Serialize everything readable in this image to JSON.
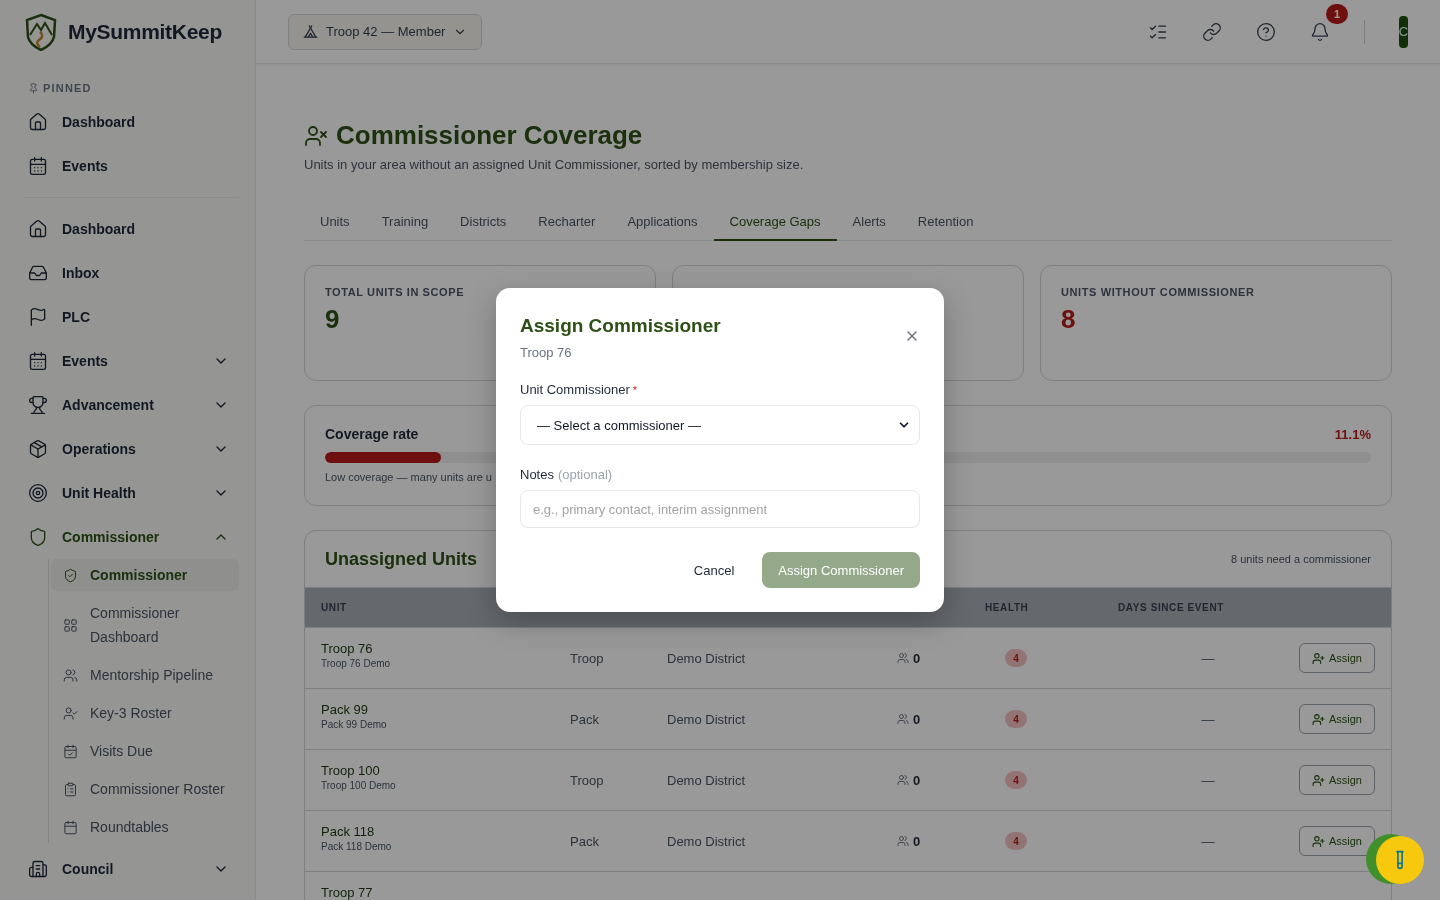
{
  "brand": {
    "name": "MySummitKeep"
  },
  "unit_switcher": {
    "label": "Troop 42 — Member"
  },
  "header": {
    "notification_count": "1",
    "avatar_initial": "C"
  },
  "sidebar": {
    "pinned_label": "PINNED",
    "pinned": [
      {
        "label": "Dashboard"
      },
      {
        "label": "Events"
      }
    ],
    "items": [
      {
        "label": "Dashboard"
      },
      {
        "label": "Inbox"
      },
      {
        "label": "PLC"
      },
      {
        "label": "Events",
        "expanded": false
      },
      {
        "label": "Advancement",
        "expanded": false
      },
      {
        "label": "Operations",
        "expanded": false
      },
      {
        "label": "Unit Health",
        "expanded": false
      },
      {
        "label": "Commissioner",
        "expanded": true,
        "children": [
          {
            "label": "Commissioner",
            "selected": true
          },
          {
            "label": "Commissioner Dashboard",
            "selected": false
          },
          {
            "label": "Mentorship Pipeline",
            "selected": false
          },
          {
            "label": "Key-3 Roster",
            "selected": false
          },
          {
            "label": "Visits Due",
            "selected": false
          },
          {
            "label": "Commissioner Roster",
            "selected": false
          },
          {
            "label": "Roundtables",
            "selected": false
          }
        ]
      },
      {
        "label": "Council",
        "expanded": false
      }
    ]
  },
  "page": {
    "title": "Commissioner Coverage",
    "subtitle": "Units in your area without an assigned Unit Commissioner, sorted by membership size."
  },
  "tabs": [
    {
      "label": "Units",
      "selected": false
    },
    {
      "label": "Training",
      "selected": false
    },
    {
      "label": "Districts",
      "selected": false
    },
    {
      "label": "Recharter",
      "selected": false
    },
    {
      "label": "Applications",
      "selected": false
    },
    {
      "label": "Coverage Gaps",
      "selected": true
    },
    {
      "label": "Alerts",
      "selected": false
    },
    {
      "label": "Retention",
      "selected": false
    }
  ],
  "stats": [
    {
      "kind": "value",
      "label": "TOTAL UNITS IN SCOPE",
      "value": "9",
      "alert": false
    },
    {
      "kind": "hidden"
    },
    {
      "kind": "value",
      "label": "UNITS WITHOUT COMMISSIONER",
      "value": "8",
      "alert": true
    }
  ],
  "coverage": {
    "title": "Coverage rate",
    "reading": "11.1%",
    "level": 0.111,
    "note": "Low coverage — many units are u"
  },
  "table": {
    "title": "Unassigned Units",
    "count": "8 units need a commissioner",
    "columns": [
      "UNIT",
      "HEALTH",
      "DAYS SINCE EVENT"
    ],
    "rows": [
      {
        "name": "Troop 76",
        "sub": "Troop 76 Demo",
        "type": "Troop",
        "district": "Demo District",
        "members": "0",
        "health": "4",
        "days": "—",
        "action": "Assign"
      },
      {
        "name": "Pack 99",
        "sub": "Pack 99 Demo",
        "type": "Pack",
        "district": "Demo District",
        "members": "0",
        "health": "4",
        "days": "—",
        "action": "Assign"
      },
      {
        "name": "Troop 100",
        "sub": "Troop 100 Demo",
        "type": "Troop",
        "district": "Demo District",
        "members": "0",
        "health": "4",
        "days": "—",
        "action": "Assign"
      },
      {
        "name": "Pack 118",
        "sub": "Pack 118 Demo",
        "type": "Pack",
        "district": "Demo District",
        "members": "0",
        "health": "4",
        "days": "—",
        "action": "Assign"
      },
      {
        "name": "Troop 77"
      }
    ]
  },
  "modal": {
    "title": "Assign Commissioner",
    "subtitle": "Troop 76",
    "select_label": "Unit Commissioner",
    "required_mark": "*",
    "select_value": "— Select a commissioner —",
    "notes_label": "Notes",
    "notes_hint": "(optional)",
    "notes_placeholder": "e.g., primary contact, interim assignment",
    "cancel": "Cancel",
    "submit": "Assign Commissioner",
    "submit_disabled": true
  }
}
